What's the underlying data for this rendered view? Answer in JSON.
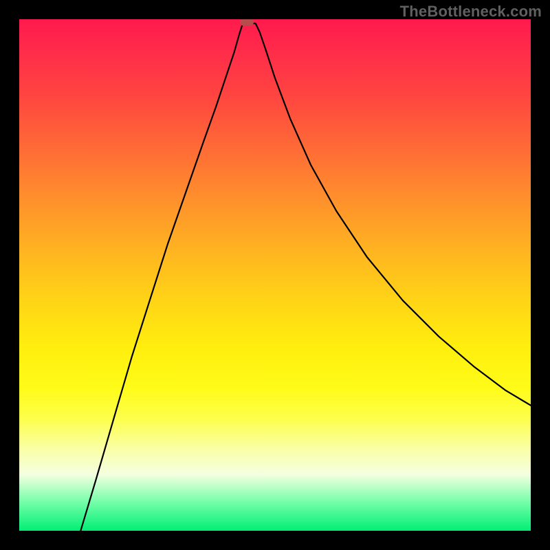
{
  "watermark": "TheBottleneck.com",
  "colors": {
    "frame_border": "#000000",
    "curve_stroke": "#000000",
    "marker_fill": "#b84b4b",
    "watermark_text": "#606060",
    "gradient_stops": [
      {
        "pos": 0.0,
        "hex": "#ff1a4d"
      },
      {
        "pos": 0.15,
        "hex": "#ff4540"
      },
      {
        "pos": 0.35,
        "hex": "#ff8f2c"
      },
      {
        "pos": 0.55,
        "hex": "#ffd416"
      },
      {
        "pos": 0.72,
        "hex": "#fffb18"
      },
      {
        "pos": 0.89,
        "hex": "#f4ffe0"
      },
      {
        "pos": 1.0,
        "hex": "#00ef74"
      }
    ]
  },
  "chart_data": {
    "type": "line",
    "title": "",
    "xlabel": "",
    "ylabel": "",
    "x_range_pct": [
      0,
      100
    ],
    "y_range_pct": [
      0,
      100
    ],
    "optimum_x_pct": 44.5,
    "marker": {
      "x_pct": 44.5,
      "y_pct": 99.4
    },
    "left_branch": [
      {
        "x_pct": 12.0,
        "y_pct": 0.0
      },
      {
        "x_pct": 15.0,
        "y_pct": 10.0
      },
      {
        "x_pct": 18.5,
        "y_pct": 22.0
      },
      {
        "x_pct": 22.0,
        "y_pct": 34.0
      },
      {
        "x_pct": 25.5,
        "y_pct": 45.0
      },
      {
        "x_pct": 29.0,
        "y_pct": 56.0
      },
      {
        "x_pct": 32.5,
        "y_pct": 66.0
      },
      {
        "x_pct": 36.0,
        "y_pct": 76.0
      },
      {
        "x_pct": 38.5,
        "y_pct": 83.0
      },
      {
        "x_pct": 40.5,
        "y_pct": 89.0
      },
      {
        "x_pct": 42.0,
        "y_pct": 93.5
      },
      {
        "x_pct": 43.0,
        "y_pct": 97.0
      },
      {
        "x_pct": 43.7,
        "y_pct": 99.2
      }
    ],
    "flat": [
      {
        "x_pct": 43.7,
        "y_pct": 99.2
      },
      {
        "x_pct": 46.2,
        "y_pct": 99.2
      }
    ],
    "right_branch": [
      {
        "x_pct": 46.2,
        "y_pct": 99.2
      },
      {
        "x_pct": 47.0,
        "y_pct": 97.5
      },
      {
        "x_pct": 48.2,
        "y_pct": 94.0
      },
      {
        "x_pct": 50.0,
        "y_pct": 88.5
      },
      {
        "x_pct": 53.0,
        "y_pct": 80.5
      },
      {
        "x_pct": 57.0,
        "y_pct": 71.5
      },
      {
        "x_pct": 62.0,
        "y_pct": 62.5
      },
      {
        "x_pct": 68.0,
        "y_pct": 53.5
      },
      {
        "x_pct": 75.0,
        "y_pct": 45.0
      },
      {
        "x_pct": 82.0,
        "y_pct": 38.0
      },
      {
        "x_pct": 89.0,
        "y_pct": 32.0
      },
      {
        "x_pct": 95.0,
        "y_pct": 27.5
      },
      {
        "x_pct": 100.0,
        "y_pct": 24.5
      }
    ]
  }
}
